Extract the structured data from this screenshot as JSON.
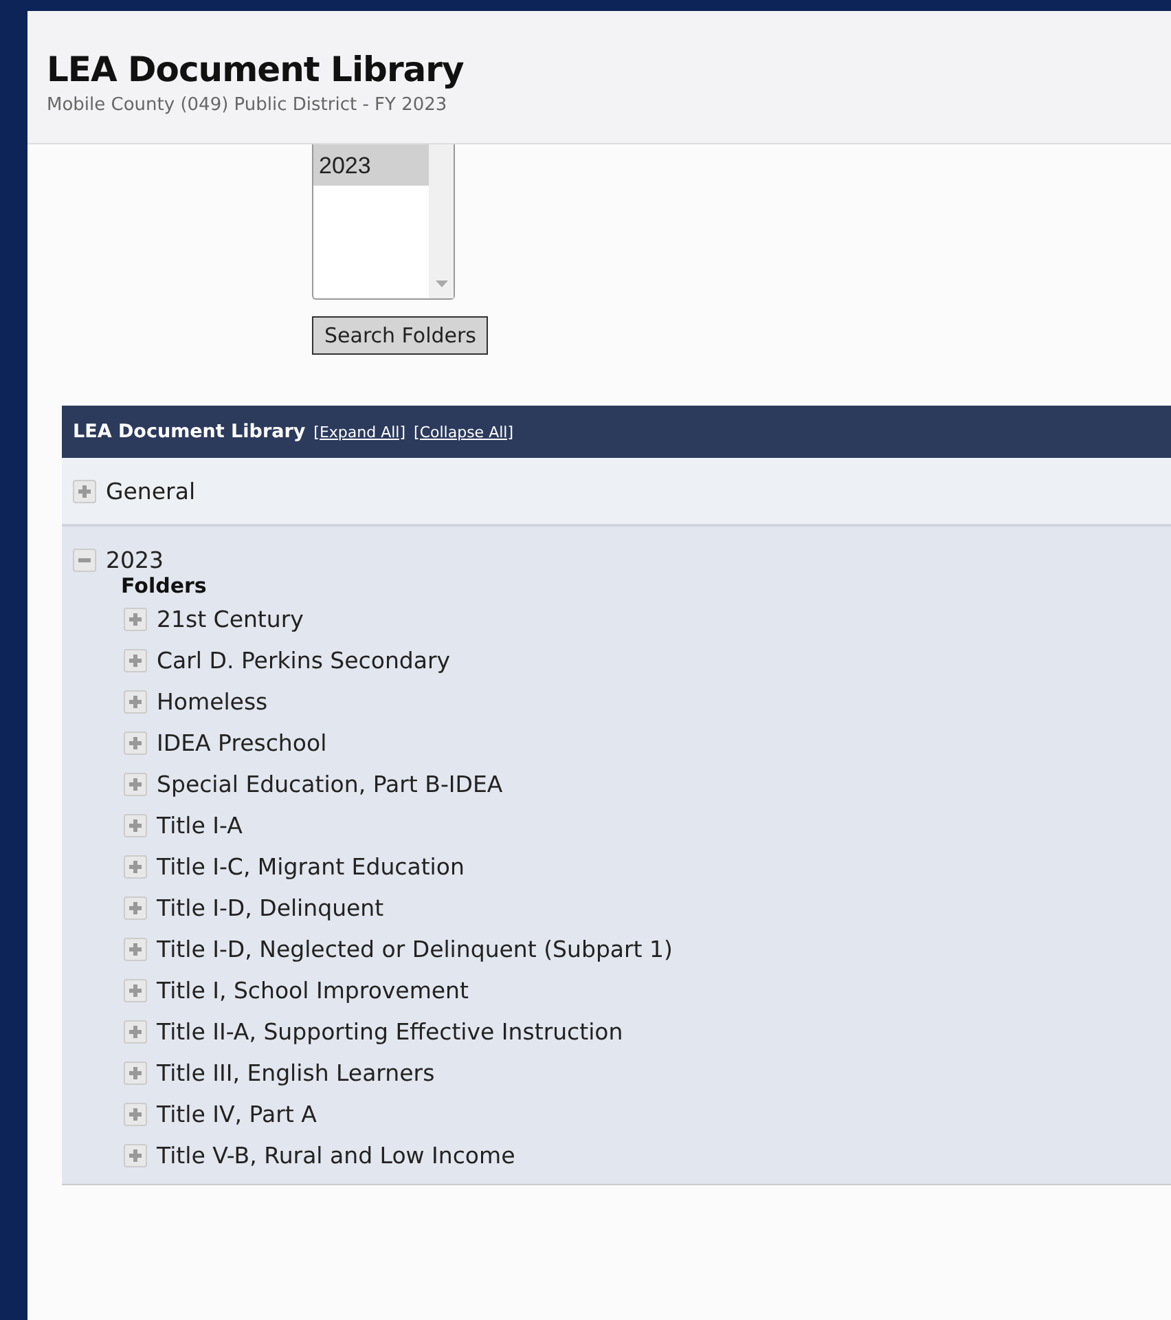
{
  "header": {
    "title": "LEA Document Library",
    "subtitle": "Mobile County (049) Public District - FY 2023"
  },
  "root_folders": {
    "options": [
      {
        "label": "2023",
        "selected": true
      }
    ]
  },
  "search_button": "Search Folders",
  "library": {
    "title": "LEA Document Library",
    "links": [
      "[Expand All]",
      "[Collapse All]"
    ],
    "nodes": [
      {
        "label": "General",
        "expanded": false
      },
      {
        "label": "2023",
        "expanded": true,
        "section_label": "Folders",
        "children": [
          {
            "label": "21st Century",
            "expanded": false
          },
          {
            "label": "Carl D. Perkins Secondary",
            "expanded": false
          },
          {
            "label": "Homeless",
            "expanded": false
          },
          {
            "label": "IDEA Preschool",
            "expanded": false
          },
          {
            "label": "Special Education, Part B-IDEA",
            "expanded": false
          },
          {
            "label": "Title I-A",
            "expanded": false
          },
          {
            "label": "Title I-C, Migrant Education",
            "expanded": false
          },
          {
            "label": "Title I-D, Delinquent",
            "expanded": false
          },
          {
            "label": "Title I-D, Neglected or Delinquent (Subpart 1)",
            "expanded": false
          },
          {
            "label": "Title I, School Improvement",
            "expanded": false
          },
          {
            "label": "Title II-A, Supporting Effective Instruction",
            "expanded": false
          },
          {
            "label": "Title III, English Learners",
            "expanded": false
          },
          {
            "label": "Title IV, Part A",
            "expanded": false
          },
          {
            "label": "Title V-B, Rural and Low Income",
            "expanded": false
          }
        ]
      }
    ]
  }
}
